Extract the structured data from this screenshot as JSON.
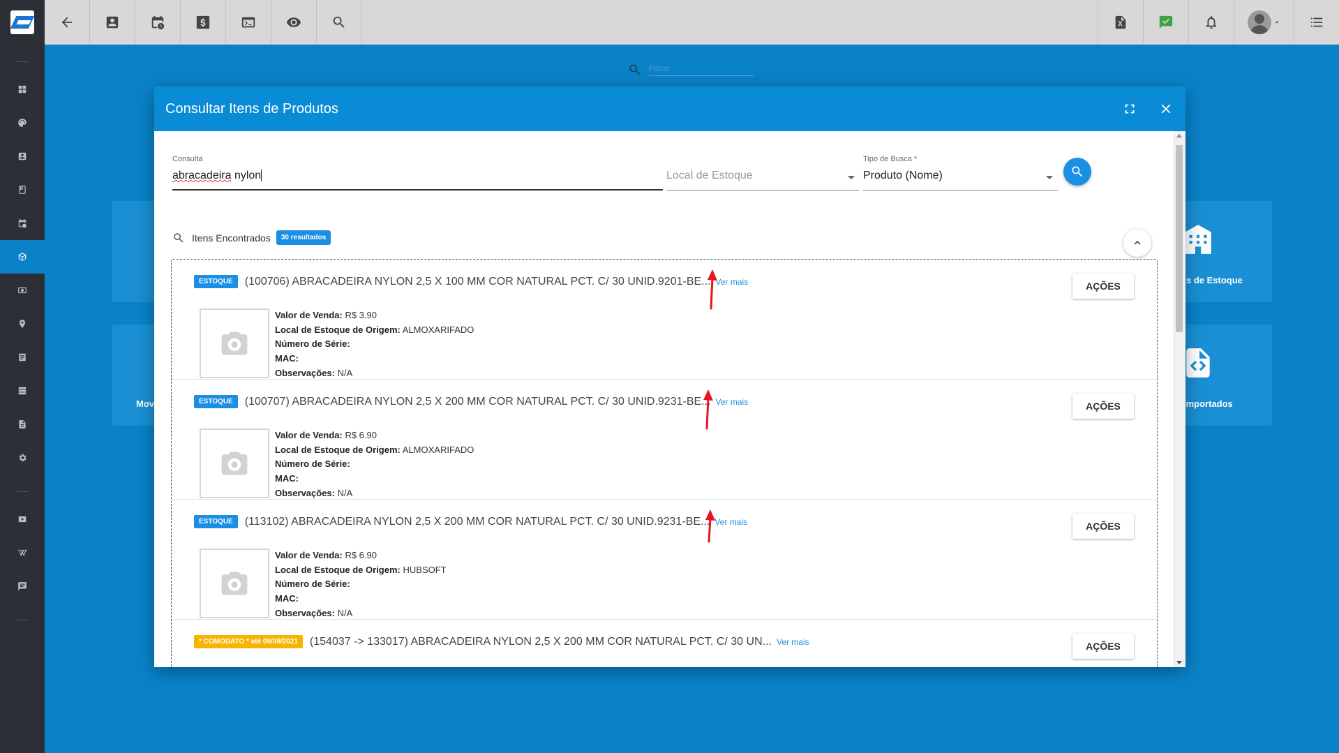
{
  "topbar": {
    "left_icons": [
      "back-arrow-icon",
      "contact-card-icon",
      "calendar-clock-icon",
      "dollar-icon",
      "terminal-icon",
      "eye-icon",
      "search-icon"
    ],
    "right_icons": [
      "pdf-icon",
      "check-message-icon",
      "bell-icon",
      "avatar",
      "menu-list-icon"
    ],
    "accent_green": "#43a047"
  },
  "sidebar": {
    "icons": [
      "grid-icon",
      "palette-icon",
      "contact-icon",
      "book-icon",
      "calendar-clock-icon",
      "box-icon",
      "money-icon",
      "map-pin-icon",
      "document-icon",
      "server-icon",
      "file-icon",
      "gear-icon",
      "play-icon",
      "wikipedia-icon",
      "chat-icon"
    ],
    "active": "box-icon"
  },
  "background": {
    "filter_placeholder": "Filtrar",
    "cards": [
      {
        "label": "s de Estoque",
        "icon": "building-icon"
      },
      {
        "label": "Movi"
      },
      {
        "label": "Importados",
        "icon": "code-file-icon"
      }
    ]
  },
  "modal": {
    "title": "Consultar Itens de Produtos",
    "header_icons": [
      "fullscreen-icon",
      "close-icon"
    ],
    "form": {
      "consulta_label": "Consulta",
      "consulta_value_misspelled": "abracadeira",
      "consulta_value_rest": " nylon",
      "local_placeholder": "Local de Estoque",
      "tipo_label": "Tipo de Busca *",
      "tipo_value": "Produto (Nome)"
    },
    "results": {
      "title": "Itens Encontrados",
      "count_badge": "30 resultados"
    },
    "labels": {
      "valor": "Valor de Venda:",
      "local": "Local de Estoque de Origem:",
      "serie": "Número de Série:",
      "mac": "MAC:",
      "obs": "Observações:",
      "ver_mais": "Ver mais",
      "acoes": "AÇÕES"
    },
    "items": [
      {
        "badge": "ESTOQUE",
        "title": "(100706) ABRACADEIRA NYLON 2,5 X 100 MM COR NATURAL PCT. C/ 30 UNID.9201-BE...",
        "valor": "R$ 3.90",
        "local": "ALMOXARIFADO",
        "serie": "",
        "mac": "",
        "obs": "N/A"
      },
      {
        "badge": "ESTOQUE",
        "title": "(100707) ABRACADEIRA NYLON 2,5 X 200 MM COR NATURAL PCT. C/ 30 UNID.9231-BE...",
        "valor": "R$ 6.90",
        "local": "ALMOXARIFADO",
        "serie": "",
        "mac": "",
        "obs": "N/A"
      },
      {
        "badge": "ESTOQUE",
        "title": "(113102) ABRACADEIRA NYLON 2,5 X 200 MM COR NATURAL PCT. C/ 30 UNID.9231-BE...",
        "valor": "R$ 6.90",
        "local": "HUBSOFT",
        "serie": "",
        "mac": "",
        "obs": "N/A"
      },
      {
        "badge": "* COMODATO * até 09/08/2021",
        "title": "(154037 -> 133017) ABRACADEIRA NYLON 2,5 X 200 MM COR NATURAL PCT. C/ 30 UN..."
      }
    ]
  },
  "colors": {
    "primary": "#0a8bd6",
    "background": "#0a82c8",
    "sidebar": "#2c3036",
    "comodato": "#f7b500",
    "annotation_arrow": "#e8141e"
  }
}
